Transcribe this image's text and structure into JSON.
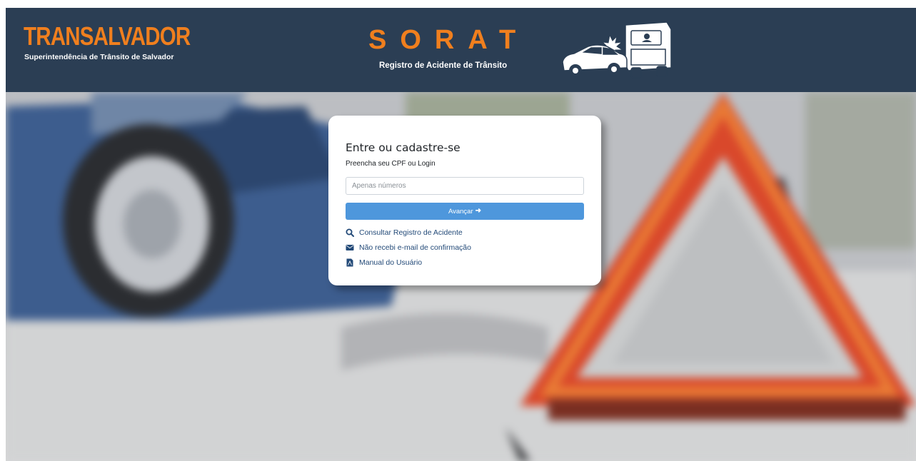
{
  "header": {
    "brand_title": "TRANSALVADOR",
    "brand_subtitle": "Superintendência de Trânsito de Salvador",
    "app_title": "SORAT",
    "app_subtitle": "Registro de Acidente de Trânsito",
    "illustration": "car-truck-crash-illustration"
  },
  "login": {
    "title": "Entre ou cadastre-se",
    "subtitle": "Preencha seu CPF ou Login",
    "cpf_input": {
      "value": "",
      "placeholder": "Apenas números"
    },
    "advance_button": {
      "label": "Avançar",
      "icon": "arrow-right-icon"
    },
    "links": [
      {
        "label": "Consultar Registro de Acidente",
        "icon": "search-icon"
      },
      {
        "label": "Não recebi e-mail de confirmação",
        "icon": "envelope-icon"
      },
      {
        "label": "Manual do Usuário",
        "icon": "pdf-file-icon"
      }
    ]
  },
  "colors": {
    "header_bg": "#2b3e54",
    "brand_orange": "#f07f1e",
    "button_blue": "#4e97dc",
    "link_blue": "#234a78"
  }
}
